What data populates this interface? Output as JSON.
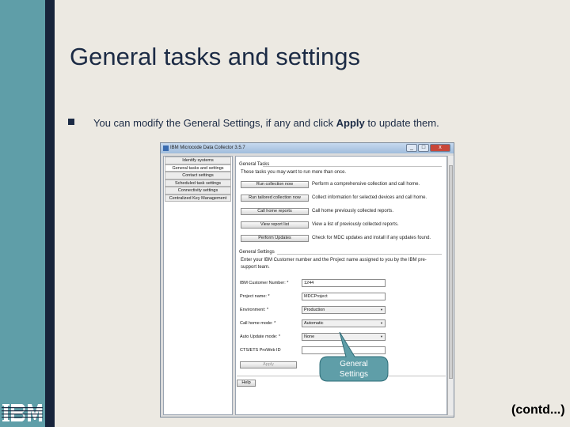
{
  "slide": {
    "title": "General tasks and settings",
    "bullet_text": "You can modify the General Settings, if any and click ",
    "bullet_bold": "Apply",
    "bullet_end": " to update them.",
    "contd": "(contd...)",
    "logo": "IBM"
  },
  "window": {
    "title": "IBM Microcode Data Collector 3.5.7",
    "minimize": "_",
    "maximize": "□",
    "close": "x",
    "nav": [
      {
        "label": "Identify systems"
      },
      {
        "label": "General tasks and settings",
        "active": true
      },
      {
        "label": "Contact settings"
      },
      {
        "label": "Scheduled task settings"
      },
      {
        "label": "Connectivity settings"
      },
      {
        "label": "Centralized Key Management"
      }
    ],
    "general_tasks_header": "General Tasks",
    "tasks_intro": "These tasks you may want to run more than once.",
    "tasks": [
      {
        "button": "Run collection now",
        "desc": "Perform a comprehensive collection and call home."
      },
      {
        "button": "Run tailored collection now",
        "desc": "Collect information for selected devices and call home."
      },
      {
        "button": "Call home reports",
        "desc": "Call home previously collected reports."
      },
      {
        "button": "View report list",
        "desc": "View a list of previously collected reports."
      },
      {
        "button": "Perform Updates",
        "desc": "Check for MDC updates and install if any updates found."
      }
    ],
    "general_settings_header": "General Settings",
    "settings_intro_1": "Enter your IBM Customer number and the Project name assigned to you by the IBM pre-",
    "settings_intro_2": "support team.",
    "fields": {
      "customer_label": "IBM Customer Number: *",
      "customer_value": "1244",
      "project_label": "Project name: *",
      "project_value": "MDCProject",
      "environment_label": "Environment: *",
      "environment_value": "Production",
      "callhome_label": "Call home mode: *",
      "callhome_value": "Automatic",
      "autoupdate_label": "Auto Update mode: *",
      "autoupdate_value": "None",
      "cts_label": "CTS/ETS ProWeb ID",
      "cts_value": ""
    },
    "apply_button": "Apply",
    "help_button": "Help"
  },
  "callout": {
    "line1": "General",
    "line2": "Settings",
    "fill": "#5f9ea8"
  }
}
